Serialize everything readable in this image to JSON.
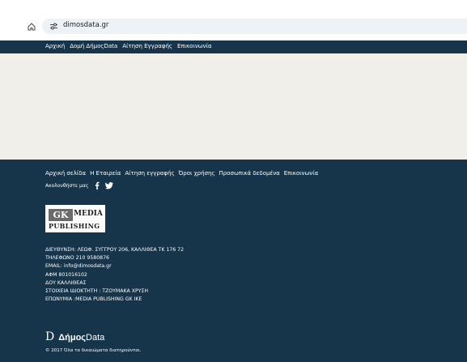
{
  "browser": {
    "url": "dimosdata.gr"
  },
  "top_nav": {
    "items": [
      {
        "label": "Αρχική"
      },
      {
        "label": "Δομή ΔήμοςData"
      },
      {
        "label": "Αίτηση Εγγραφής"
      },
      {
        "label": "Επικοινωνία"
      }
    ]
  },
  "footer": {
    "links": [
      {
        "label": "Αρχική σελίδα"
      },
      {
        "label": "Η Εταιρεία"
      },
      {
        "label": "Αίτηση εγγραφής"
      },
      {
        "label": "Όροι χρήσης"
      },
      {
        "label": "Προσωπικά δεδομένα"
      },
      {
        "label": "Επικοινωνία"
      }
    ],
    "follow_label": "Ακολουθήστε μας",
    "logo": {
      "gk": "GK",
      "media": "MEDIA",
      "publishing": "PUBLISHING"
    },
    "contact_lines": [
      "ΔΙΕΥΘΥΝΣΗ: ΛΕΩΦ. ΣΥΓΓΡΟΥ 206, ΚΑΛΛΙΘΕΑ ΤΚ 176 72",
      "ΤΗΛΕΦΩΝΟ 210 9580876",
      "EMAIL: info@dimosdata.gr",
      "ΑΦΜ 801016102",
      "ΔΟΥ ΚΑΛΛΙΘΕΑΣ",
      "ΣΤΟΙΧΕΙΑ ΙΔΙΟΚΤΗΤΗ : ΤΖΟΥΜΑΚΑ ΧΡΥΣΗ",
      "ΕΠΩΝΥΜΙΑ :MEDIA PUBLISHING GK IKE"
    ],
    "brand": {
      "mark": "D",
      "name": "Δήμος",
      "suffix": "Data"
    },
    "copyright": "© 2017 Όλα τα δικαιώματα διατηρούνται."
  },
  "colors": {
    "nav_bg": "#16344a",
    "content_bg": "#f1efea",
    "url_bar_bg": "#eef1f6"
  }
}
